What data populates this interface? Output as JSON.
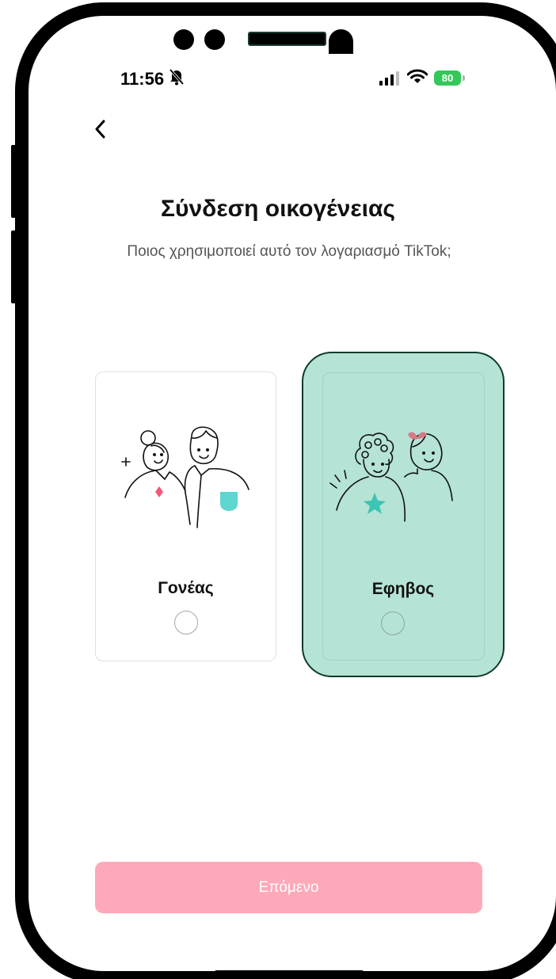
{
  "status_bar": {
    "time": "11:56",
    "battery": "80"
  },
  "header": {
    "back_icon": "chevron-left-icon"
  },
  "title": "Σύνδεση οικογένειας",
  "subtitle": "Ποιος χρησιμοποιεί αυτό τον λογαριασμό TikTok;",
  "options": [
    {
      "label": "Γονέας",
      "illustration": "parent-illustration",
      "selected": false
    },
    {
      "label": "Εφηβος",
      "illustration": "teen-illustration",
      "selected": false,
      "highlighted": true
    }
  ],
  "next_button": {
    "label": "Επόμενο",
    "enabled": false
  },
  "colors": {
    "accent_disabled": "#fea9b9",
    "highlight_fill": "#b5e3d6",
    "highlight_border": "#0e3b2b",
    "illustration_teal": "#5fd6cf",
    "illustration_pink": "#f05a78"
  }
}
